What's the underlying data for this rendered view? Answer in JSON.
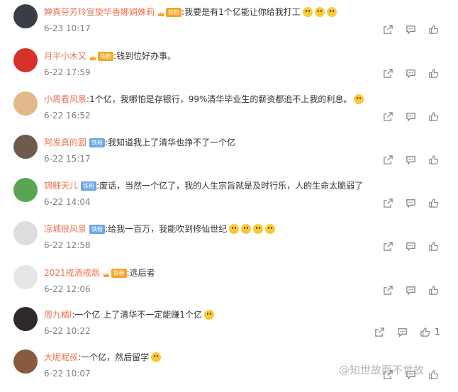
{
  "comments": [
    {
      "username": "婵真芬芳玲宣旋华香娜娟姝莉",
      "badge": "铁粉",
      "badge_style": "gold",
      "crown": true,
      "text": "我要是有1个亿能让你给我打工",
      "emoji_count": 3,
      "time": "6-23 10:17",
      "likes": "",
      "avatar": "avatar-dark"
    },
    {
      "username": "月半小木又",
      "badge": "铁粉",
      "badge_style": "gold",
      "crown": true,
      "text": "钱到位好办事。",
      "emoji_count": 0,
      "time": "6-22 17:59",
      "likes": "",
      "avatar": "avatar-red"
    },
    {
      "username": "小周看风景",
      "badge": "",
      "badge_style": "",
      "crown": false,
      "text": "1个亿，我哪怕是存银行，99%清华毕业生的薪资都追不上我的利息。",
      "emoji_count": 1,
      "time": "6-22 16:52",
      "likes": "",
      "avatar": "avatar-dog"
    },
    {
      "username": "阿发真的圆",
      "badge": "铁粉",
      "badge_style": "blue",
      "crown": false,
      "text": "我知道我上了清华也挣不了一个亿",
      "emoji_count": 0,
      "time": "6-22 15:17",
      "likes": "",
      "avatar": "avatar-person"
    },
    {
      "username": "锦鲤天儿",
      "badge": "铁粉",
      "badge_style": "blue",
      "crown": false,
      "text": "废话，当然一个亿了，我的人生宗旨就是及时行乐，人的生命太脆弱了",
      "emoji_count": 0,
      "time": "6-22 14:04",
      "likes": "",
      "avatar": "avatar-green"
    },
    {
      "username": "凉城很风景",
      "badge": "铁粉",
      "badge_style": "blue",
      "crown": false,
      "text": "给我一百万，我能吹到修仙世纪",
      "emoji_count": 4,
      "time": "6-22 12:58",
      "likes": "",
      "avatar": "avatar-blank"
    },
    {
      "username": "2021戒酒戒烟",
      "badge": "铁粉",
      "badge_style": "gold",
      "crown": true,
      "text": "选后者",
      "emoji_count": 0,
      "time": "6-22 12:06",
      "likes": "",
      "avatar": "avatar-anime"
    },
    {
      "username": "周九橘l",
      "badge": "",
      "badge_style": "",
      "crown": false,
      "text": "一个亿 上了清华不一定能赚1个亿",
      "emoji_count": 1,
      "time": "6-22 10:22",
      "likes": "1",
      "avatar": "avatar-girl"
    },
    {
      "username": "大昵昵叔",
      "badge": "",
      "badge_style": "",
      "crown": false,
      "text": "一个亿，然后留学",
      "emoji_count": 1,
      "time": "6-22 10:07",
      "likes": "",
      "avatar": "avatar-brown"
    }
  ],
  "icons": {
    "share": "share-icon",
    "comment": "comment-icon",
    "like": "thumbs-up-icon"
  },
  "colors": {
    "username": "#eb7350",
    "time": "#808080",
    "badge_gold": "#f5a623",
    "badge_blue": "#6aa8e8"
  },
  "watermark": "@知世故而不世故"
}
